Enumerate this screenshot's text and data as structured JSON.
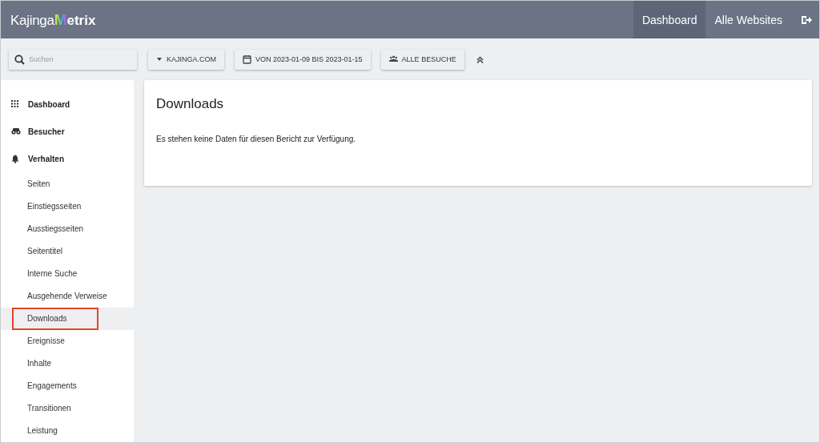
{
  "header": {
    "logo": [
      "Kajinga",
      "M",
      "etrix"
    ],
    "nav": [
      {
        "label": "Dashboard",
        "selected": true
      },
      {
        "label": "Alle Websites",
        "selected": false
      }
    ]
  },
  "toolbar": {
    "search": {
      "placeholder": "Suchen"
    },
    "filters": [
      {
        "kind": "caret",
        "label": "KAJINGA.COM"
      },
      {
        "kind": "calendar",
        "label": "VON 2023-01-09 BIS 2023-01-15"
      },
      {
        "kind": "group",
        "label": "ALLE BESUCHE"
      }
    ]
  },
  "sidebar": {
    "items": [
      {
        "kind": "grid",
        "label": "Dashboard",
        "selected": false
      },
      {
        "kind": "binoculars",
        "label": "Besucher",
        "selected": false
      },
      {
        "kind": "bell",
        "label": "Verhalten",
        "selected": false,
        "children": [
          {
            "label": "Seiten",
            "selected": false,
            "marked": false
          },
          {
            "label": "Einstiegsseiten",
            "selected": false,
            "marked": false
          },
          {
            "label": "Ausstiegsseiten",
            "selected": false,
            "marked": false
          },
          {
            "label": "Seitentitel",
            "selected": false,
            "marked": false
          },
          {
            "label": "Interne Suche",
            "selected": false,
            "marked": false
          },
          {
            "label": "Ausgehende Verweise",
            "selected": false,
            "marked": false
          },
          {
            "label": "Downloads",
            "selected": true,
            "marked": true
          },
          {
            "label": "Ereignisse",
            "selected": false,
            "marked": false
          },
          {
            "label": "Inhalte",
            "selected": false,
            "marked": false
          },
          {
            "label": "Engagements",
            "selected": false,
            "marked": false
          },
          {
            "label": "Transitionen",
            "selected": false,
            "marked": false
          },
          {
            "label": "Leistung",
            "selected": false,
            "marked": false
          }
        ]
      }
    ]
  },
  "report": {
    "title": "Downloads",
    "message": "Es stehen keine Daten für diesen Bericht zur Verfügung."
  }
}
